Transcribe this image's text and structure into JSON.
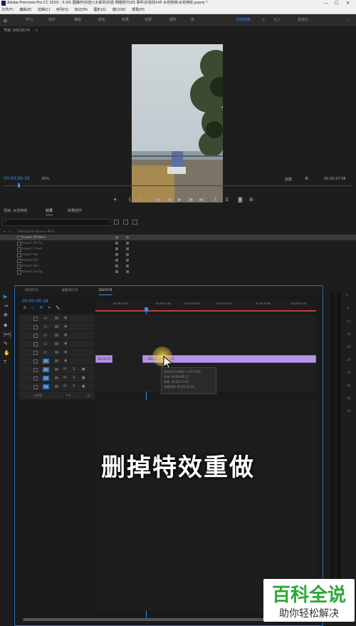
{
  "window": {
    "title": "Adobe Premiere Pro CC 2019 - X:\\01 图播作\\抖音六大系列\\抖音 网络技巧\\03 事件\\抖音的145 水花特效\\水花特效.prproj *",
    "controls": [
      "—",
      "☐",
      "✕"
    ]
  },
  "menu": [
    "文件(F)",
    "编辑(E)",
    "剪辑(C)",
    "序列(S)",
    "标记(M)",
    "图形(G)",
    "窗口(W)",
    "帮助(H)"
  ],
  "workspaces": [
    "学习",
    "组件",
    "编辑",
    "颜色",
    "效果",
    "音频",
    "图形",
    "库",
    "所有面板",
    "元入",
    "元面板",
    "无效",
    "其他元"
  ],
  "workspace_active": "所有面板",
  "monitor": {
    "panel_title": "节目: DSC9174",
    "timecode": "00:00:06:18",
    "zoom": "20%",
    "quality": "完整",
    "duration": "00:02:27:08"
  },
  "project": {
    "tabs": [
      "项目: 水花特效",
      "效果",
      "效果控件"
    ],
    "active_tab": "效果",
    "folder": "TXImageCell Bounce Pack",
    "items": [
      "Impact 3D Block",
      "Impact 3D Flip",
      "Impact C Push",
      "Impact Pop",
      "Impact Pull",
      "Impact Spin",
      "Impact Spring"
    ]
  },
  "timeline": {
    "tabs": [
      "DSC9174",
      "嵌套序列 02",
      "DSC9174"
    ],
    "timecode": "00:00:06:18",
    "ruler": [
      "00:00:05:00",
      "00:00:07:00",
      "00:00:08:00",
      "00:00:09:00",
      "00:00:10:00",
      "00:00:11:00"
    ],
    "video_tracks": [
      "V6",
      "V5",
      "V4",
      "V3",
      "V2",
      "V1"
    ],
    "audio_tracks": [
      "A1",
      "A2",
      "A3"
    ],
    "master": "主声道",
    "master_value": "0.0",
    "clip_left": "DSC9174 [V]",
    "clip_main": "DSC9174.MOV [V]",
    "tooltip": [
      "DSC9174.MOV 1:107.00%",
      "开始: 00:00:06:15",
      "结束: 00:00:17:07",
      "持续时间: 00:00:11:16"
    ]
  },
  "meter_labels": [
    "0",
    "-6",
    "-12",
    "-18",
    "-24",
    "-30",
    "-36",
    "-42",
    "-48",
    "-54"
  ],
  "caption": "删掉特效重做",
  "watermark": {
    "big": "百科全说",
    "small": "助你轻松解决"
  },
  "colors": {
    "accent": "#2f8ff0",
    "clip": "#b595e8",
    "brand_green": "#2da838"
  }
}
